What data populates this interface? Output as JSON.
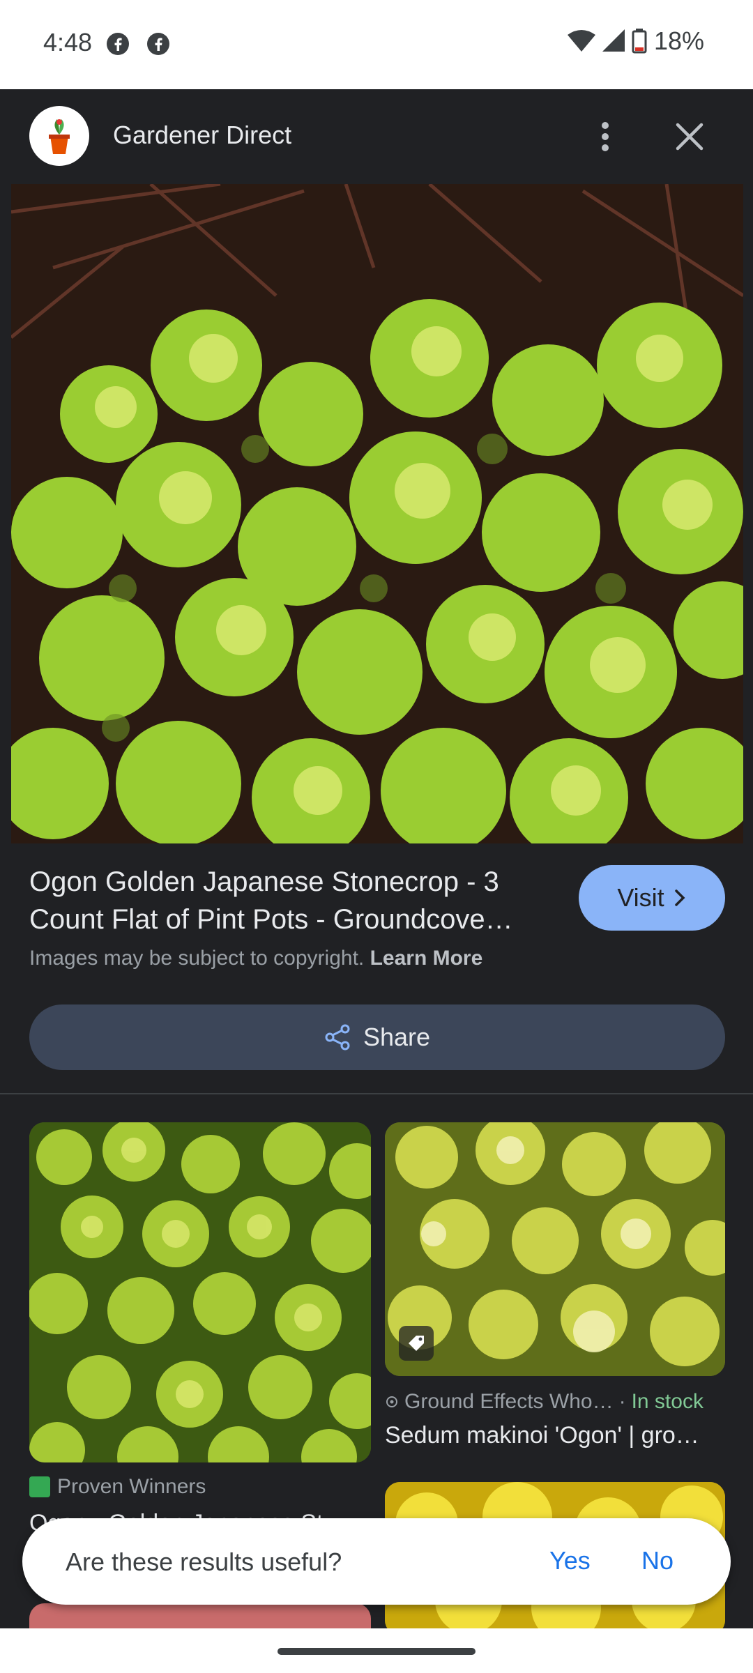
{
  "status_bar": {
    "time": "4:48",
    "battery": "18%",
    "icons": [
      "facebook-icon",
      "facebook-icon",
      "wifi-icon",
      "signal-icon",
      "battery-icon"
    ]
  },
  "header": {
    "site_name": "Gardener Direct",
    "more_icon": "more-vert-icon",
    "close_icon": "close-icon"
  },
  "result": {
    "title": "Ogon Golden Japanese Stonecrop - 3 Count Flat of Pint Pots - Groundcove…",
    "copyright_text": "Images may be subject to copyright.",
    "learn_more": "Learn More",
    "visit_label": "Visit",
    "share_label": "Share"
  },
  "related": [
    {
      "source": "Proven Winners",
      "title": "Ogon - Golden Japanese St…"
    },
    {
      "source": "Ground Effects Who…",
      "stock_separator": "·",
      "stock": "In stock",
      "title": "Sedum makinoi 'Ogon' | gro…"
    }
  ],
  "feedback": {
    "question": "Are these results useful?",
    "yes": "Yes",
    "no": "No"
  },
  "colors": {
    "background": "#202124",
    "accent": "#8ab4f8",
    "share_bg": "#3c4659",
    "in_stock": "#81c995",
    "link": "#1a73e8"
  }
}
